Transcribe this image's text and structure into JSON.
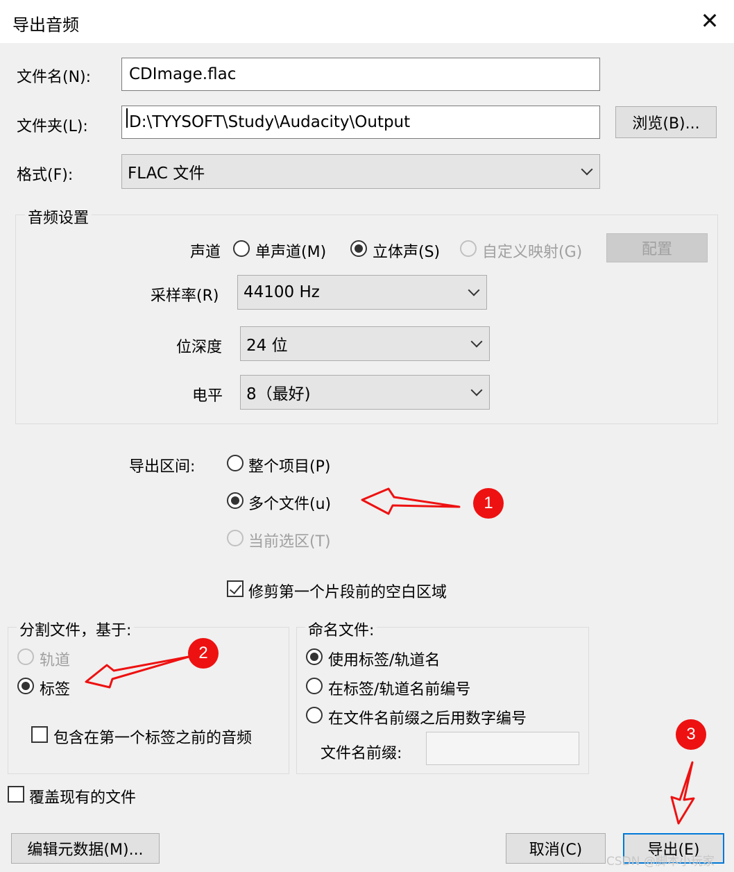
{
  "window": {
    "title": "导出音频",
    "close_glyph": "✕"
  },
  "file_name": {
    "label": "文件名(N):",
    "value": "CDImage.flac"
  },
  "folder": {
    "label": "文件夹(L):",
    "value": "D:\\TYYSOFT\\Study\\Audacity\\Output",
    "browse_label": "浏览(B)..."
  },
  "format": {
    "label": "格式(F):",
    "value": "FLAC 文件"
  },
  "audio_settings": {
    "title": "音频设置",
    "channels": {
      "label": "声道",
      "options": [
        {
          "label": "单声道(M)",
          "selected": false,
          "enabled": true
        },
        {
          "label": "立体声(S)",
          "selected": true,
          "enabled": true
        },
        {
          "label": "自定义映射(G)",
          "selected": false,
          "enabled": false
        }
      ],
      "configure_label": "配置"
    },
    "sample_rate": {
      "label": "采样率(R)",
      "value": "44100 Hz"
    },
    "bit_depth": {
      "label": "位深度",
      "value": "24 位"
    },
    "level": {
      "label": "电平",
      "value": "8（最好)"
    }
  },
  "export_range": {
    "label": "导出区间:",
    "options": [
      {
        "label": "整个项目(P)",
        "selected": false,
        "enabled": true
      },
      {
        "label": "多个文件(u)",
        "selected": true,
        "enabled": true
      },
      {
        "label": "当前选区(T)",
        "selected": false,
        "enabled": false
      }
    ]
  },
  "trim_blank": {
    "label": "修剪第一个片段前的空白区域",
    "checked": true
  },
  "split_by": {
    "title": "分割文件，基于:",
    "options": [
      {
        "label": "轨道",
        "selected": false,
        "enabled": false
      },
      {
        "label": "标签",
        "selected": true,
        "enabled": true
      }
    ],
    "include_audio_label": "包含在第一个标签之前的音频",
    "include_audio_checked": false
  },
  "name_files": {
    "title": "命名文件:",
    "options": [
      {
        "label": "使用标签/轨道名",
        "selected": true
      },
      {
        "label": "在标签/轨道名前编号",
        "selected": false
      },
      {
        "label": "在文件名前缀之后用数字编号",
        "selected": false
      }
    ],
    "prefix_label": "文件名前缀:",
    "prefix_value": ""
  },
  "overwrite": {
    "label": "覆盖现有的文件",
    "checked": false
  },
  "buttons": {
    "edit_metadata": "编辑元数据(M)...",
    "cancel": "取消(C)",
    "export": "导出(E)"
  },
  "annotations": {
    "first": "1",
    "second": "2",
    "third": "3",
    "arrow_color": "#ee1111"
  },
  "watermark": "CSDN @脚本小玩家"
}
